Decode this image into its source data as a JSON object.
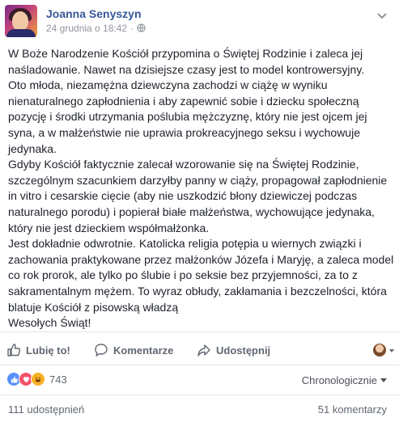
{
  "post": {
    "author": "Joanna Senyszyn",
    "timestamp": "24 grudnia o 18:42",
    "separator": "·",
    "text": "W Boże Narodzenie Kościół przypomina o Świętej Rodzinie i zaleca jej naśladowanie. Nawet na dzisiejsze czasy jest to model kontrowersyjny.\nOto młoda, niezamężna dziewczyna zachodzi w ciążę w wyniku nienaturalnego zapłodnienia i aby zapewnić sobie i dziecku społeczną pozycję i środki utrzymania poślubia mężczyznę, który nie jest ojcem jej syna, a w małżeństwie nie uprawia prokreacyjnego seksu i wychowuje jedynaka.\nGdyby Kościół faktycznie zalecał wzorowanie się na Świętej Rodzinie, szczególnym szacunkiem darzyłby panny w ciąży, propagował zapłodnienie in vitro i cesarskie cięcie (aby nie uszkodzić błony dziewiczej podczas naturalnego porodu) i popierał białe małżeństwa, wychowujące jedynaka, który nie jest dzieckiem współmałżonka.\nJest dokładnie odwrotnie. Katolicka religia potępia u wiernych związki i zachowania praktykowane przez małżonków Józefa i Maryję, a zaleca model co rok prorok, ale tylko po ślubie i po seksie bez przyjemności, za to z sakramentalnym mężem. To wyraz obłudy, zakłamania i bezczelności, która blatuje Kościół z pisowską władzą\nWesołych Świąt!"
  },
  "actions": {
    "like_label": "Lubię to!",
    "comment_label": "Komentarze",
    "share_label": "Udostępnij"
  },
  "stats": {
    "reaction_count": "743",
    "sort_label": "Chronologicznie",
    "shares_text": "111 udostępnień",
    "comments_text": "51 komentarzy"
  },
  "icons": {
    "like": "thumbs-up-icon",
    "comment": "speech-bubble-icon",
    "share": "share-arrow-icon",
    "privacy": "globe-icon",
    "menu": "chevron-down-icon",
    "reactions": [
      "like-reaction-icon",
      "love-reaction-icon",
      "haha-reaction-icon"
    ]
  },
  "colors": {
    "author_link": "#365899",
    "like_reaction": "#5890ff",
    "love_reaction": "#f25268",
    "haha_reaction": "#f7b125"
  }
}
